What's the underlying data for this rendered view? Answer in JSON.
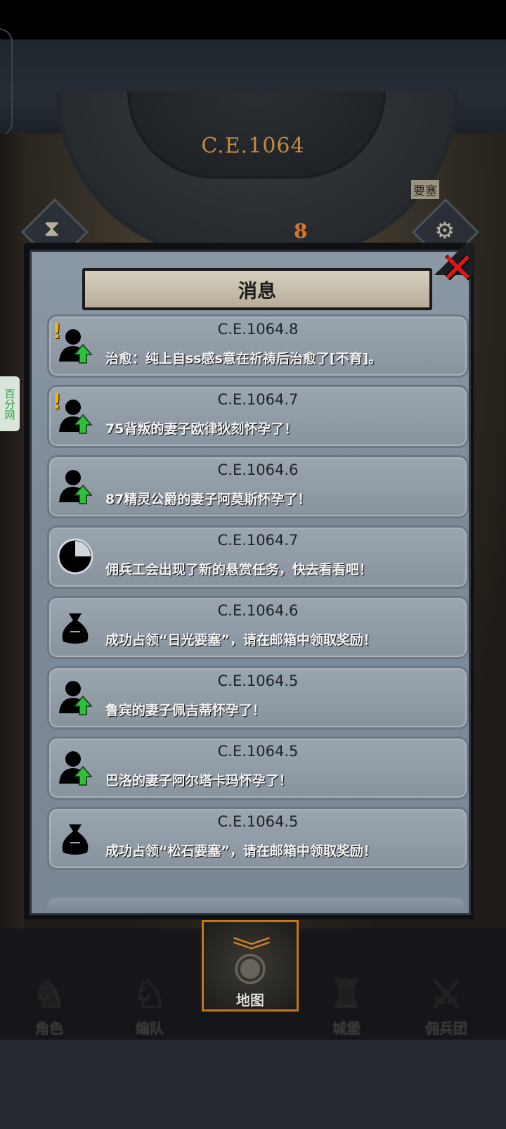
{
  "calendar": {
    "year": "C.E.1064",
    "month": "8",
    "map_label": "要塞"
  },
  "side_tab": "百分网",
  "dialog": {
    "title": "消息",
    "close_icon": "close-x-icon"
  },
  "messages": [
    {
      "date": "C.E.1064.8",
      "text": "治愈：纯上自ss感s意在祈祷后治愈了[不育]。",
      "icon": "person-up-icon",
      "alert": "!"
    },
    {
      "date": "C.E.1064.7",
      "text": "75背叛的妻子欧律狄刻怀孕了！",
      "icon": "person-up-icon",
      "alert": "!"
    },
    {
      "date": "C.E.1064.6",
      "text": "87精灵公爵的妻子阿莫斯怀孕了！",
      "icon": "person-up-icon",
      "alert": ""
    },
    {
      "date": "C.E.1064.7",
      "text": "佣兵工会出现了新的悬赏任务，快去看看吧！",
      "icon": "pie-clock-icon",
      "alert": ""
    },
    {
      "date": "C.E.1064.6",
      "text": "成功占领“日光要塞”，请在邮箱中领取奖励！",
      "icon": "money-bag-icon",
      "alert": ""
    },
    {
      "date": "C.E.1064.5",
      "text": "鲁宾的妻子佩吉蒂怀孕了！",
      "icon": "person-up-icon",
      "alert": ""
    },
    {
      "date": "C.E.1064.5",
      "text": "巴洛的妻子阿尔塔卡玛怀孕了！",
      "icon": "person-up-icon",
      "alert": ""
    },
    {
      "date": "C.E.1064.5",
      "text": "成功占领“松石要塞”，请在邮箱中领取奖励！",
      "icon": "money-bag-icon",
      "alert": ""
    }
  ],
  "nav": [
    {
      "label": "角色",
      "icon": "knight-icon",
      "active": false
    },
    {
      "label": "编队",
      "icon": "armored-knight-icon",
      "active": false
    },
    {
      "label": "地图",
      "icon": "globe-map-icon",
      "active": true
    },
    {
      "label": "城堡",
      "icon": "castle-icon",
      "active": false
    },
    {
      "label": "佣兵团",
      "icon": "mercenary-icon",
      "active": false
    }
  ],
  "colors": {
    "accent_orange": "#c4741f",
    "close_red": "#d91818",
    "alert_yellow": "#f4b300",
    "arrow_green": "#2fbf3a"
  }
}
